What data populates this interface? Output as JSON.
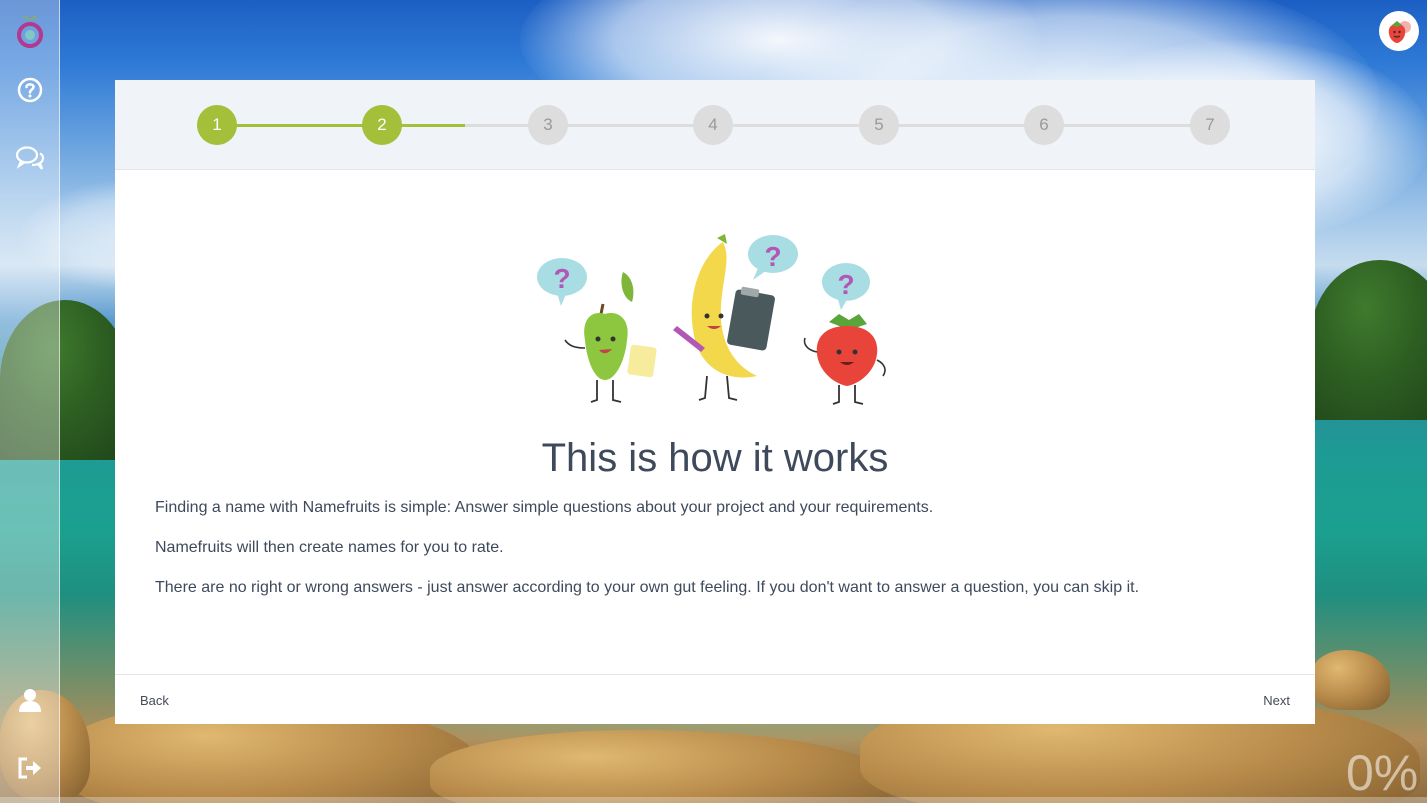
{
  "sidebar": {
    "logo_icon": "namefruits-logo-icon",
    "items": [
      {
        "name": "help",
        "icon": "question-circle-icon"
      },
      {
        "name": "chat",
        "icon": "chat-bubbles-icon"
      },
      {
        "name": "account",
        "icon": "user-icon"
      },
      {
        "name": "logout",
        "icon": "sign-out-icon"
      }
    ]
  },
  "header": {
    "avatar_icon": "strawberry-avatar-icon"
  },
  "stepper": {
    "current": 2,
    "steps": [
      "1",
      "2",
      "3",
      "4",
      "5",
      "6",
      "7"
    ]
  },
  "content": {
    "illustration": "fruit-characters-illustration",
    "title": "This is how it works",
    "paragraphs": [
      "Finding a name with Namefruits is simple: Answer simple questions about your project and your requirements.",
      "Namefruits will then create names for you to rate.",
      "There are no right or wrong answers - just answer according to your own gut feeling. If you don't want to answer a question, you can skip it."
    ]
  },
  "footer": {
    "back_label": "Back",
    "next_label": "Next"
  },
  "progress": {
    "label": "0%",
    "value": 0
  },
  "colors": {
    "accent": "#a4bf3a",
    "step_inactive": "#dddddd",
    "text": "#3e4a5c"
  }
}
